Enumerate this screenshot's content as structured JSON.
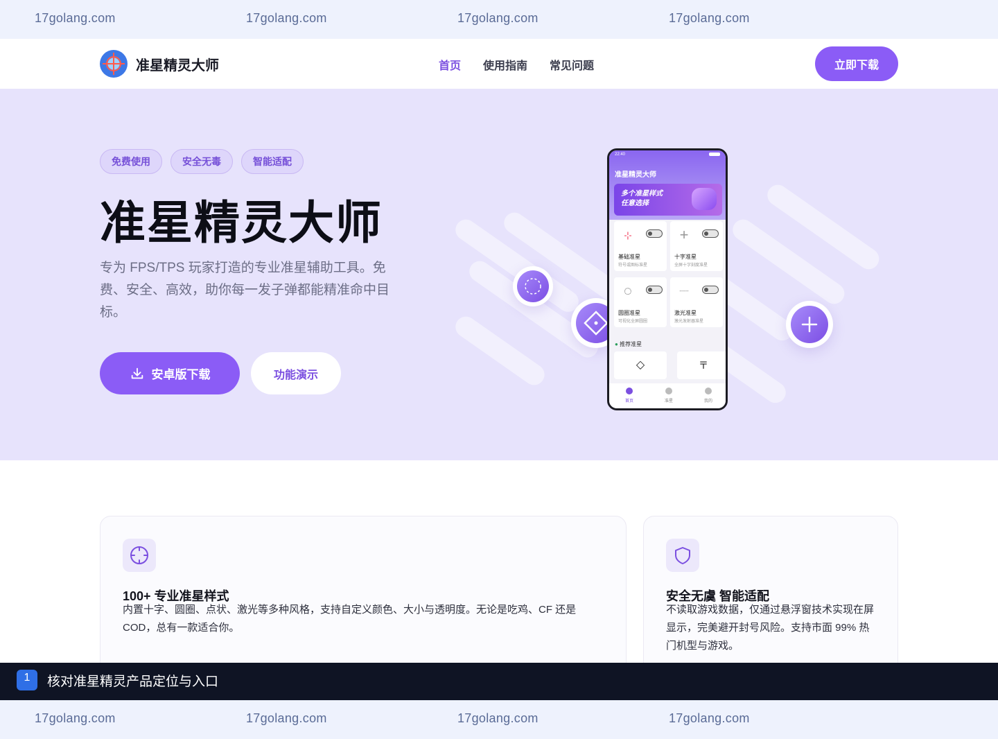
{
  "watermark": {
    "top": [
      "17golang.com",
      "17golang.com",
      "17golang.com",
      "17golang.com"
    ],
    "bottom": [
      "17golang.com",
      "17golang.com",
      "17golang.com",
      "17golang.com"
    ]
  },
  "header": {
    "brand": "准星精灵大师",
    "nav": [
      {
        "label": "首页",
        "active": true
      },
      {
        "label": "使用指南",
        "active": false
      },
      {
        "label": "常见问题",
        "active": false
      }
    ],
    "cta": "立即下载"
  },
  "hero": {
    "tags": [
      "免费使用",
      "安全无毒",
      "智能适配"
    ],
    "title": "准星精灵大师",
    "description": "专为 FPS/TPS 玩家打造的专业准星辅助工具。免费、安全、高效，助你每一发子弹都能精准命中目标。",
    "primary_button": "安卓版下载",
    "secondary_button": "功能演示"
  },
  "phone": {
    "status_time": "22:40",
    "app_name": "准星精灵大师",
    "banner": [
      "多个准星样式",
      "任意选择"
    ],
    "cards": [
      {
        "title": "基础准星",
        "subtitle": "符号或图标准星",
        "symbol": "-¦-"
      },
      {
        "title": "十字准星",
        "subtitle": "全屏十字刻度准星",
        "symbol": "+"
      },
      {
        "title": "圆圈准星",
        "subtitle": "可视化全屏圆圈",
        "symbol": "◌"
      },
      {
        "title": "激光准星",
        "subtitle": "激光发射器准星",
        "symbol": "-----"
      }
    ],
    "recommend_label": "推荐准星",
    "recommend_symbols": [
      "◇",
      "〒"
    ],
    "tabs": [
      {
        "label": "首页",
        "active": true
      },
      {
        "label": "准星",
        "active": false
      },
      {
        "label": "我的",
        "active": false
      }
    ]
  },
  "features": [
    {
      "icon": "crosshair-icon",
      "title": "100+ 专业准星样式",
      "description": "内置十字、圆圈、点状、激光等多种风格，支持自定义颜色、大小与透明度。无论是吃鸡、CF 还是 COD，总有一款适合你。"
    },
    {
      "icon": "shield-icon",
      "title": "安全无虞 智能适配",
      "description": "不读取游戏数据，仅通过悬浮窗技术实现在屏显示，完美避开封号风险。支持市面 99% 热门机型与游戏。"
    }
  ],
  "step_bar": {
    "number": "1",
    "text": "核对准星精灵产品定位与入口"
  },
  "colors": {
    "accent": "#8b5cf6",
    "hero_bg": "#e7e3fc",
    "watermark_bg": "#eef2fd",
    "step_bar_bg": "#0f1424"
  }
}
